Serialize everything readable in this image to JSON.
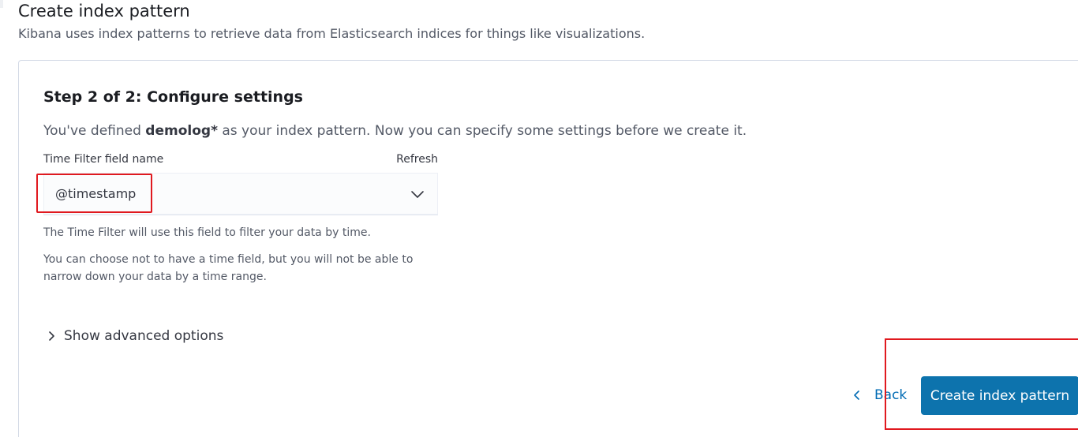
{
  "header": {
    "title": "Create index pattern",
    "subtitle": "Kibana uses index patterns to retrieve data from Elasticsearch indices for things like visualizations."
  },
  "step": {
    "title": "Step 2 of 2: Configure settings",
    "defined_prefix": "You've defined ",
    "pattern": "demolog*",
    "defined_suffix": " as your index pattern. Now you can specify some settings before we create it."
  },
  "time_filter": {
    "label": "Time Filter field name",
    "refresh_label": "Refresh",
    "selected_value": "@timestamp",
    "help_1": "The Time Filter will use this field to filter your data by time.",
    "help_2": "You can choose not to have a time field, but you will not be able to narrow down your data by a time range."
  },
  "advanced": {
    "label": "Show advanced options"
  },
  "footer": {
    "back_label": "Back",
    "create_label": "Create index pattern"
  },
  "icons": {
    "select_chevron": "chevron-down-icon",
    "advanced_chevron": "chevron-right-icon",
    "back_chevron": "chevron-left-icon"
  },
  "colors": {
    "primary": "#0d73ad",
    "link": "#006bb4",
    "annotation": "#e0191f",
    "border": "#d3dae6"
  }
}
